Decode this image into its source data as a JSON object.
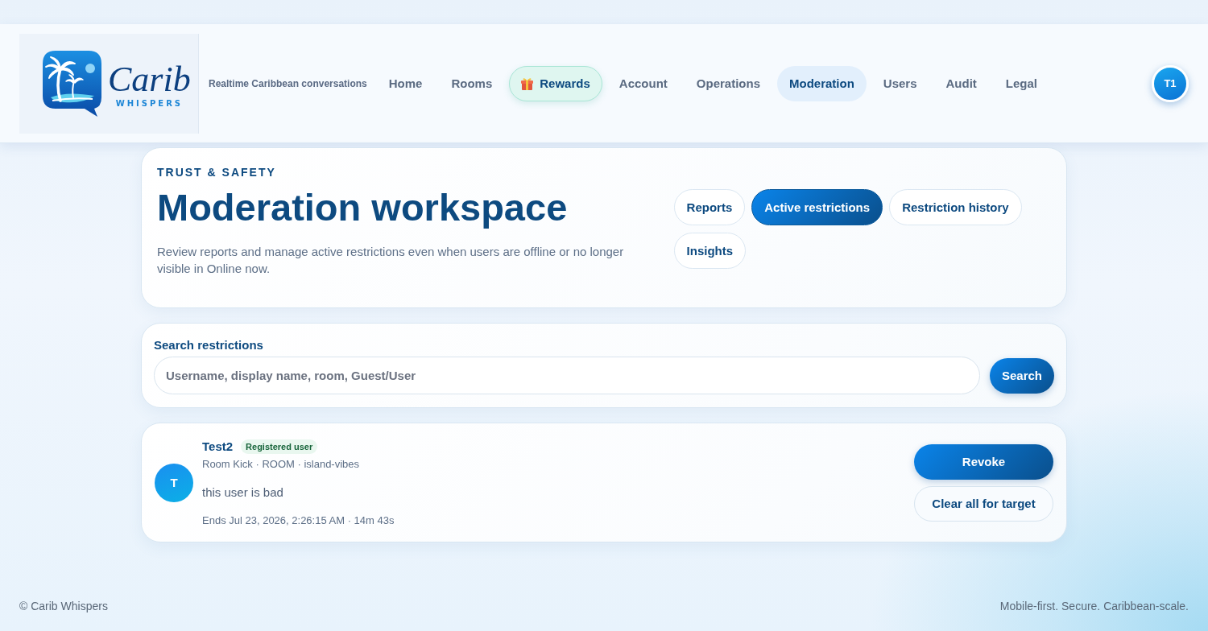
{
  "header": {
    "logo": {
      "wordmark": "Carib",
      "subtitle": "WHISPERS"
    },
    "tagline": "Realtime Caribbean conversations",
    "nav": [
      {
        "label": "Home",
        "kind": "link",
        "selected": false
      },
      {
        "label": "Rooms",
        "kind": "link",
        "selected": false
      },
      {
        "label": "Rewards",
        "kind": "promo",
        "selected": false
      },
      {
        "label": "Account",
        "kind": "link",
        "selected": false
      },
      {
        "label": "Operations",
        "kind": "link",
        "selected": false
      },
      {
        "label": "Moderation",
        "kind": "link",
        "selected": true
      },
      {
        "label": "Users",
        "kind": "link",
        "selected": false
      },
      {
        "label": "Audit",
        "kind": "link",
        "selected": false
      },
      {
        "label": "Legal",
        "kind": "link",
        "selected": false
      }
    ],
    "avatar": "T1"
  },
  "hero": {
    "eyebrow": "TRUST & SAFETY",
    "title": "Moderation workspace",
    "description": "Review reports and manage active restrictions even when users are offline or no longer visible in Online now.",
    "tabs": [
      {
        "label": "Reports",
        "selected": false
      },
      {
        "label": "Active restrictions",
        "selected": true
      },
      {
        "label": "Restriction history",
        "selected": false
      },
      {
        "label": "Insights",
        "selected": false
      }
    ]
  },
  "search": {
    "label": "Search restrictions",
    "placeholder": "Username, display name, room, Guest/User",
    "button": "Search"
  },
  "restrictions": [
    {
      "avatar": "T",
      "name": "Test2",
      "badge": "Registered user",
      "details": "Room Kick · ROOM · island-vibes",
      "reason": "this user is bad",
      "ends": "Ends Jul 23, 2026, 2:26:15 AM · 14m 43s",
      "actions": [
        {
          "label": "Revoke",
          "kind": "primary"
        },
        {
          "label": "Clear all for target",
          "kind": "secondary"
        }
      ]
    }
  ],
  "footer": {
    "copyright": "© Carib Whispers",
    "tagline": "Mobile-first. Secure. Caribbean-scale."
  }
}
